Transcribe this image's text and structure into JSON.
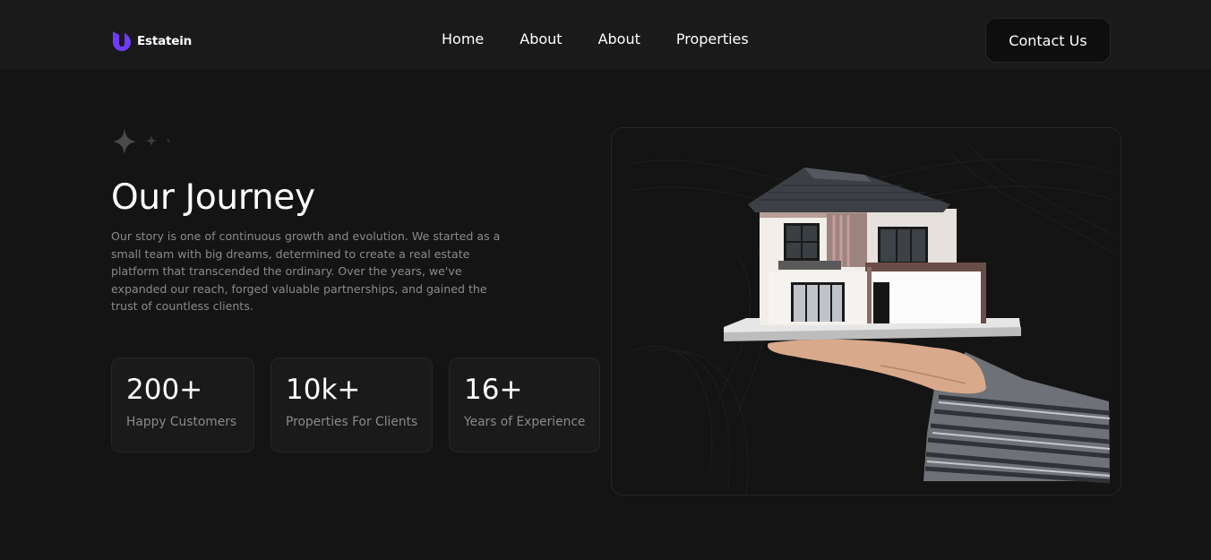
{
  "brand": {
    "name": "Estatein",
    "accent": "#703bf7"
  },
  "nav": {
    "links": [
      "Home",
      "About",
      "About",
      "Properties"
    ],
    "cta": "Contact Us"
  },
  "hero": {
    "title": "Our Journey",
    "description": "Our story is one of continuous growth and evolution. We started as a small team with big dreams, determined to create a real estate platform that transcended the ordinary. Over the years, we've expanded our reach, forged valuable partnerships, and gained the trust of countless clients.",
    "decoration_icon": "sparkles-icon",
    "image_icon": "house-in-hand-illustration"
  },
  "stats": [
    {
      "value": "200+",
      "label": "Happy Customers"
    },
    {
      "value": "10k+",
      "label": "Properties For Clients"
    },
    {
      "value": "16+",
      "label": "Years of Experience"
    }
  ],
  "colors": {
    "background": "#141414",
    "navbar": "#1a1a1a",
    "card": "#1a1a1a",
    "border": "#262626",
    "muted_text": "#8a8a8a"
  }
}
